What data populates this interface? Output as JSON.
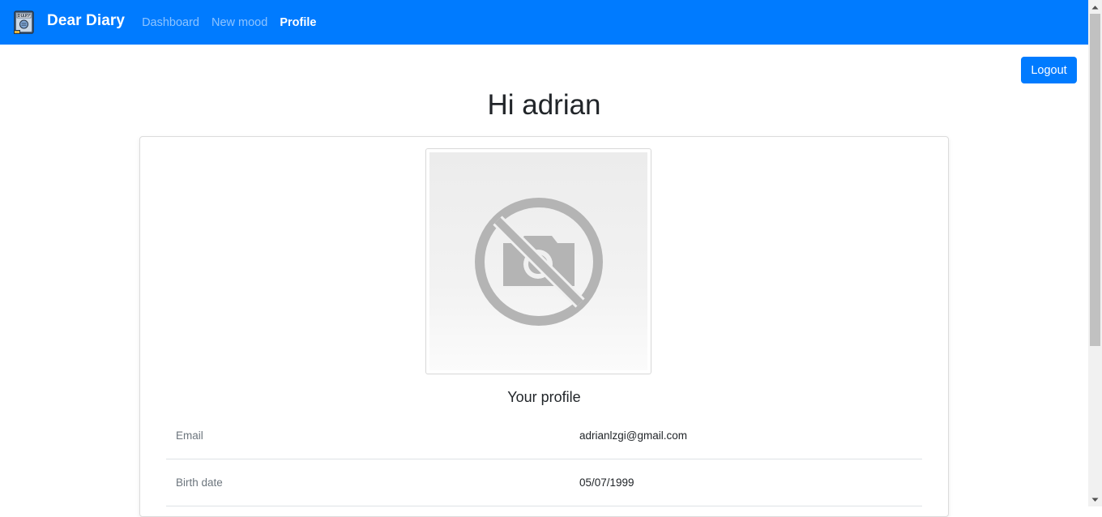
{
  "navbar": {
    "brand_name": "Dear Diary",
    "logo_text": "DIARY",
    "links": [
      {
        "label": "Dashboard",
        "active": false
      },
      {
        "label": "New mood",
        "active": false
      },
      {
        "label": "Profile",
        "active": true
      }
    ],
    "color": "#007bff"
  },
  "logout_label": "Logout",
  "greeting": "Hi adrian",
  "profile": {
    "photo_icon": "no-photo-icon",
    "heading": "Your profile",
    "fields": [
      {
        "label": "Email",
        "value": "adrianlzgi@gmail.com"
      },
      {
        "label": "Birth date",
        "value": "05/07/1999"
      }
    ]
  }
}
